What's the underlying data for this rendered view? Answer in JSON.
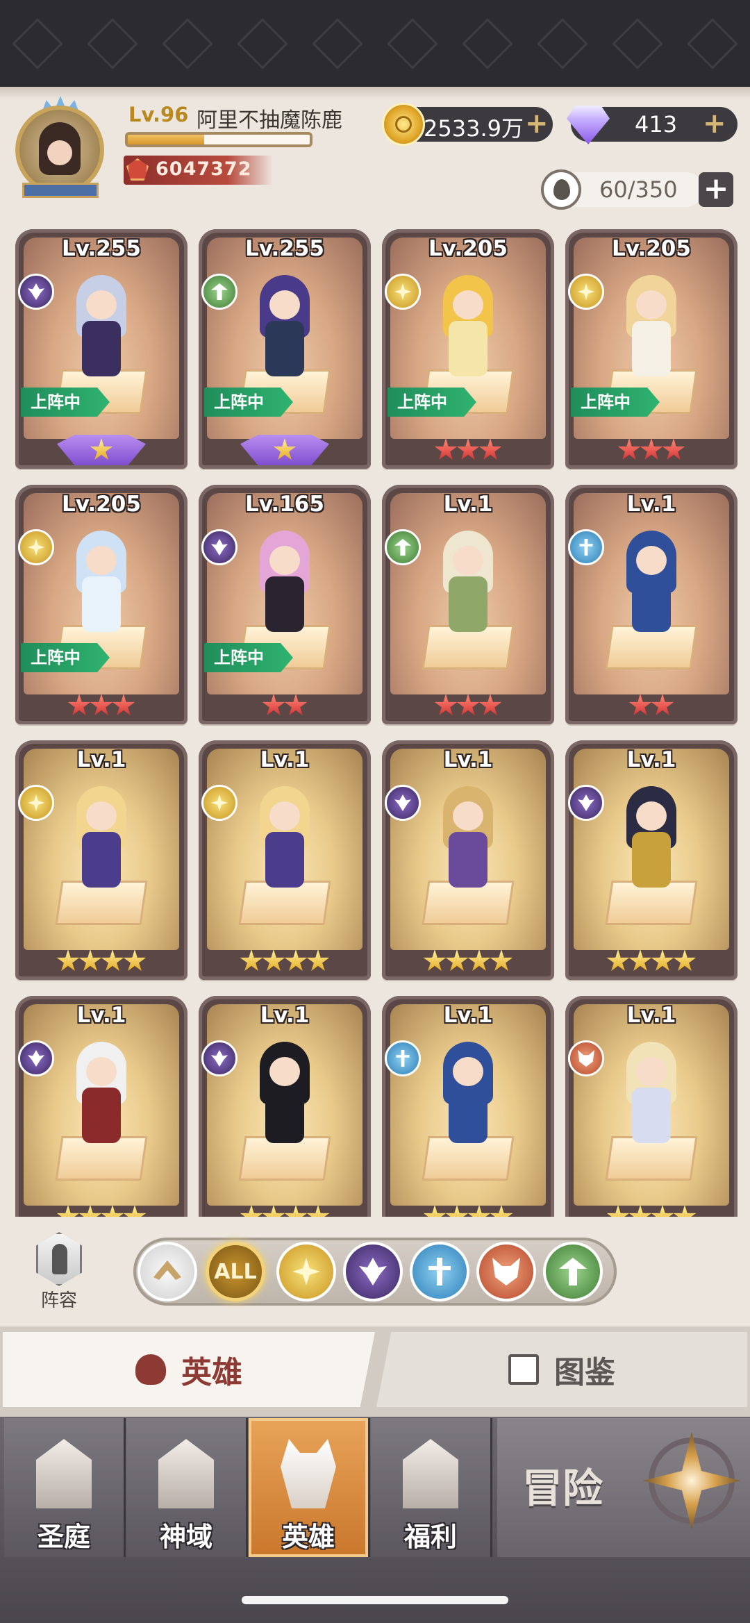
{
  "player": {
    "level": "Lv.96",
    "name": "阿里不抽魔陈鹿",
    "exp_fraction": 0.42,
    "power": "6047372"
  },
  "currency": {
    "gold": "2533.9万",
    "diamonds": "413",
    "hero_capacity": "60/350"
  },
  "heroes": [
    {
      "level": "Lv.255",
      "faction": "dark-icon",
      "deployed": true,
      "stars": 1,
      "star_color": "purple",
      "hair": "#c6cfe6",
      "body": "#3b2f5f"
    },
    {
      "level": "Lv.255",
      "faction": "nature-icon",
      "deployed": true,
      "stars": 1,
      "star_color": "purple",
      "hair": "#4a3a8a",
      "body": "#2c3858"
    },
    {
      "level": "Lv.205",
      "faction": "holy-icon",
      "deployed": true,
      "stars": 3,
      "star_color": "red",
      "hair": "#f2c44a",
      "body": "#f4e6a8"
    },
    {
      "level": "Lv.205",
      "faction": "holy-icon",
      "deployed": true,
      "stars": 3,
      "star_color": "red",
      "hair": "#f1d49a",
      "body": "#f4f0e6"
    },
    {
      "level": "Lv.205",
      "faction": "holy-icon",
      "deployed": true,
      "stars": 3,
      "star_color": "red",
      "hair": "#cfe2f5",
      "body": "#e8f2fb"
    },
    {
      "level": "Lv.165",
      "faction": "dark-icon",
      "deployed": true,
      "stars": 2,
      "star_color": "red",
      "hair": "#e3a6d6",
      "body": "#2a2430"
    },
    {
      "level": "Lv.1",
      "faction": "nature-icon",
      "deployed": false,
      "stars": 3,
      "star_color": "red",
      "hair": "#efe6d0",
      "body": "#8fa86a"
    },
    {
      "level": "Lv.1",
      "faction": "tech-icon",
      "deployed": false,
      "stars": 2,
      "star_color": "red",
      "hair": "#2f4f9a",
      "body": "#2f4f9a"
    },
    {
      "level": "Lv.1",
      "faction": "holy-icon",
      "deployed": false,
      "stars": 4,
      "star_color": "gold",
      "hair": "#f2d690",
      "body": "#4c3d8c"
    },
    {
      "level": "Lv.1",
      "faction": "holy-icon",
      "deployed": false,
      "stars": 4,
      "star_color": "gold",
      "hair": "#f2d690",
      "body": "#4c3d8c"
    },
    {
      "level": "Lv.1",
      "faction": "dark-icon",
      "deployed": false,
      "stars": 4,
      "star_color": "gold",
      "hair": "#d8b46e",
      "body": "#6a4a9a"
    },
    {
      "level": "Lv.1",
      "faction": "dark-icon",
      "deployed": false,
      "stars": 4,
      "star_color": "gold",
      "hair": "#2b2b44",
      "body": "#c9a13a"
    },
    {
      "level": "Lv.1",
      "faction": "dark-icon",
      "deployed": false,
      "stars": 4,
      "star_color": "gold",
      "hair": "#f0f0f0",
      "body": "#8a2a2a"
    },
    {
      "level": "Lv.1",
      "faction": "dark-icon",
      "deployed": false,
      "stars": 4,
      "star_color": "gold",
      "hair": "#1c1c22",
      "body": "#1c1c22"
    },
    {
      "level": "Lv.1",
      "faction": "tech-icon",
      "deployed": false,
      "stars": 4,
      "star_color": "gold",
      "hair": "#2f4f9a",
      "body": "#2f4f9a"
    },
    {
      "level": "Lv.1",
      "faction": "beast-icon",
      "deployed": false,
      "stars": 4,
      "star_color": "gold",
      "hair": "#f2e2b8",
      "body": "#d8dcf0"
    }
  ],
  "deployed_label": "上阵中",
  "formation_label": "阵容",
  "filters": {
    "all_label": "ALL"
  },
  "tabs": {
    "heroes": "英雄",
    "codex": "图鉴"
  },
  "nav": {
    "sanctuary": "圣庭",
    "divine_realm": "神域",
    "heroes": "英雄",
    "welfare": "福利",
    "adventure": "冒险"
  }
}
